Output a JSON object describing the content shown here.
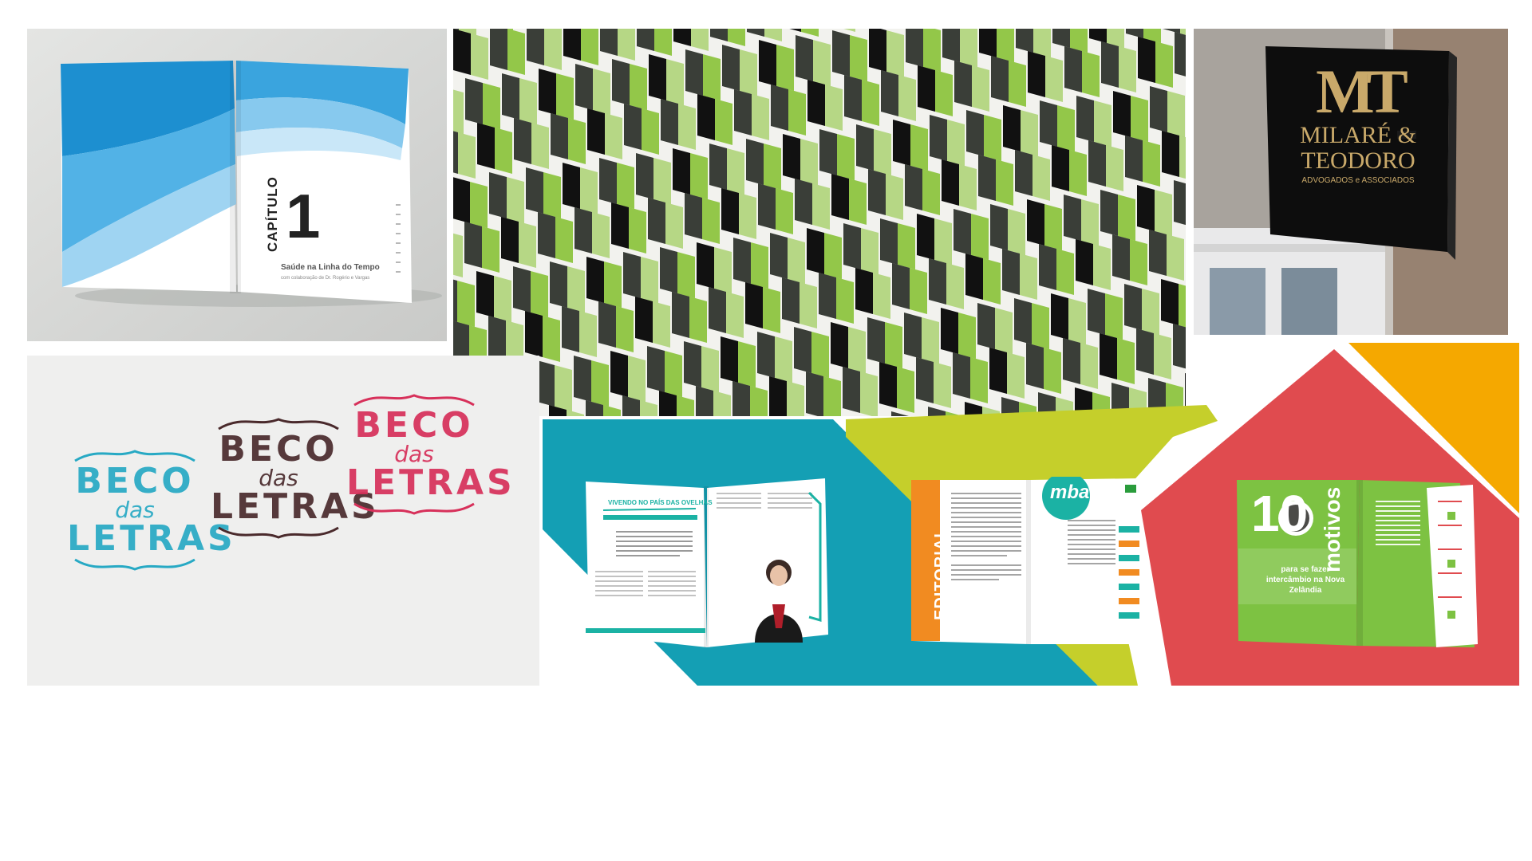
{
  "tiles": {
    "book_chapter": {
      "chapter_word": "CAPÍTULO",
      "chapter_number": "1",
      "subtitle": "Saúde na Linha do Tempo",
      "byline": "com colaboração de Dr. Rogério e Vargas"
    },
    "pattern": {},
    "signage": {
      "monogram": "MT",
      "name_line1": "MILARÉ &",
      "name_line2": "TEODORO",
      "tagline": "ADVOGADOS e ASSOCIADOS"
    },
    "logo_print": {
      "logos": [
        {
          "line1": "BECO",
          "line2": "das",
          "line3": "LETRAS",
          "color": "#27a9c4"
        },
        {
          "line1": "BECO",
          "line2": "das",
          "line3": "LETRAS",
          "color": "#4a2a2c"
        },
        {
          "line1": "BECO",
          "line2": "das",
          "line3": "LETRAS",
          "color": "#d7305a"
        }
      ]
    },
    "magazine_interview": {
      "headline": "VIVENDO NO PAÍS DAS OVELHAS"
    },
    "magazine_editorial": {
      "side_title": "EDITORIAL",
      "badge": "mba"
    },
    "magazine_motivos": {
      "number": "10",
      "vertical_word": "motivos",
      "caption": "para se fazer intercâmbio na Nova Zelândia"
    }
  },
  "colors": {
    "teal_band": "#149fb4",
    "lime_arrow": "#c5cf2b",
    "red_panel": "#e04b4f",
    "orange_corner": "#f5a800",
    "pattern_lime": "#8dc43f",
    "pattern_dark": "#3a3e38"
  }
}
